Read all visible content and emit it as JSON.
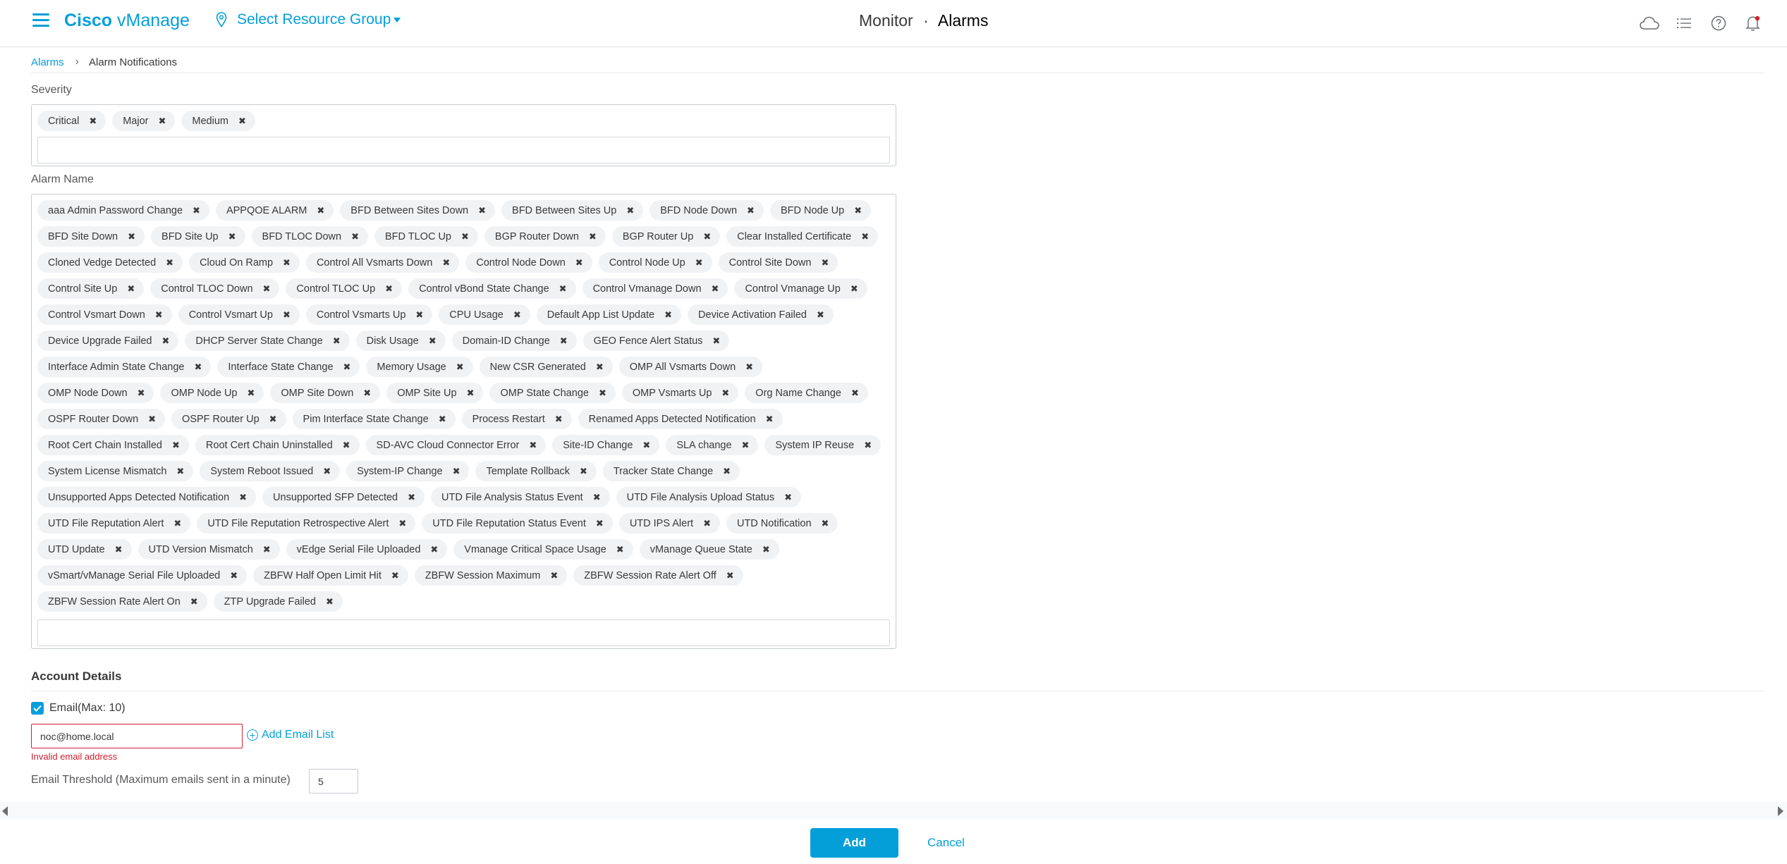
{
  "header": {
    "brand_bold": "Cisco",
    "brand_light": "vManage",
    "resource_group": "Select Resource Group",
    "title_section": "Monitor",
    "title_separator": "·",
    "title_page": "Alarms",
    "icons": [
      "cloud-icon",
      "task-list-icon",
      "help-icon",
      "notification-bell-icon"
    ]
  },
  "breadcrumb": {
    "parent": "Alarms",
    "current": "Alarm Notifications"
  },
  "severity": {
    "label": "Severity",
    "tags": [
      "Critical",
      "Major",
      "Medium"
    ]
  },
  "alarm_name": {
    "label": "Alarm Name",
    "tags": [
      "aaa Admin Password Change",
      "APPQOE ALARM",
      "BFD Between Sites Down",
      "BFD Between Sites Up",
      "BFD Node Down",
      "BFD Node Up",
      "BFD Site Down",
      "BFD Site Up",
      "BFD TLOC Down",
      "BFD TLOC Up",
      "BGP Router Down",
      "BGP Router Up",
      "Clear Installed Certificate",
      "Cloned Vedge Detected",
      "Cloud On Ramp",
      "Control All Vsmarts Down",
      "Control Node Down",
      "Control Node Up",
      "Control Site Down",
      "Control Site Up",
      "Control TLOC Down",
      "Control TLOC Up",
      "Control vBond State Change",
      "Control Vmanage Down",
      "Control Vmanage Up",
      "Control Vsmart Down",
      "Control Vsmart Up",
      "Control Vsmarts Up",
      "CPU Usage",
      "Default App List Update",
      "Device Activation Failed",
      "Device Upgrade Failed",
      "DHCP Server State Change",
      "Disk Usage",
      "Domain-ID Change",
      "GEO Fence Alert Status",
      "Interface Admin State Change",
      "Interface State Change",
      "Memory Usage",
      "New CSR Generated",
      "OMP All Vsmarts Down",
      "OMP Node Down",
      "OMP Node Up",
      "OMP Site Down",
      "OMP Site Up",
      "OMP State Change",
      "OMP Vsmarts Up",
      "Org Name Change",
      "OSPF Router Down",
      "OSPF Router Up",
      "Pim Interface State Change",
      "Process Restart",
      "Renamed Apps Detected Notification",
      "Root Cert Chain Installed",
      "Root Cert Chain Uninstalled",
      "SD-AVC Cloud Connector Error",
      "Site-ID Change",
      "SLA change",
      "System IP Reuse",
      "System License Mismatch",
      "System Reboot Issued",
      "System-IP Change",
      "Template Rollback",
      "Tracker State Change",
      "Unsupported Apps Detected Notification",
      "Unsupported SFP Detected",
      "UTD File Analysis Status Event",
      "UTD File Analysis Upload Status",
      "UTD File Reputation Alert",
      "UTD File Reputation Retrospective Alert",
      "UTD File Reputation Status Event",
      "UTD IPS Alert",
      "UTD Notification",
      "UTD Update",
      "UTD Version Mismatch",
      "vEdge Serial File Uploaded",
      "Vmanage Critical Space Usage",
      "vManage Queue State",
      "vSmart/vManage Serial File Uploaded",
      "ZBFW Half Open Limit Hit",
      "ZBFW Session Maximum",
      "ZBFW Session Rate Alert Off",
      "ZBFW Session Rate Alert On",
      "ZTP Upgrade Failed"
    ]
  },
  "tag_remove_glyph": "✖",
  "account": {
    "title": "Account Details",
    "email_checkbox_label": "Email(Max: 10)",
    "email_checked": true,
    "email_value": "noc@home.local",
    "add_email_label": "Add Email List",
    "error_text": "Invalid email address",
    "threshold_label": "Email Threshold (Maximum emails sent in a minute)",
    "threshold_value": "5"
  },
  "footer": {
    "add_label": "Add",
    "cancel_label": "Cancel"
  },
  "colors": {
    "accent": "#049fd9",
    "error": "#cf2030",
    "tag_bg": "#f1f2f4"
  }
}
